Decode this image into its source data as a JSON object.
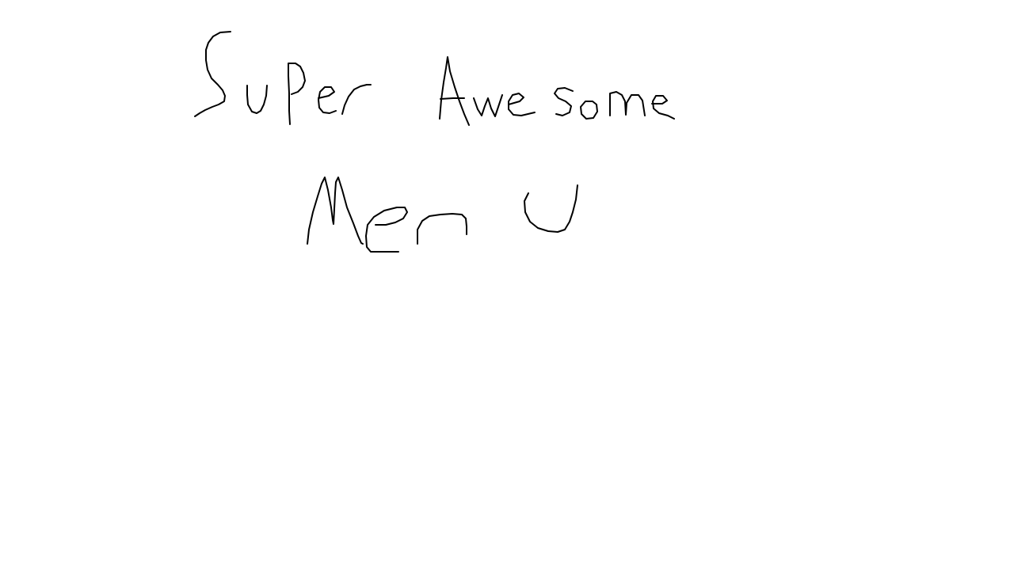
{
  "handwritten_title": {
    "line1": "Super Awesome",
    "line2": "Men U"
  },
  "colors": {
    "background": "#ffffff",
    "ink": "#000000"
  }
}
